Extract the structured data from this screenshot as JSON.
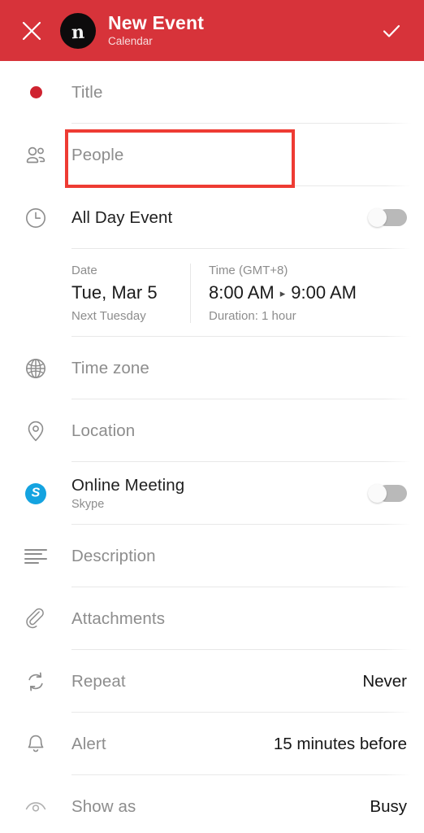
{
  "header": {
    "close_icon": "close-x-icon",
    "avatar_glyph": "n",
    "title": "New Event",
    "subtitle": "Calendar",
    "done_icon": "checkmark-icon",
    "background_color": "#d7333a"
  },
  "form": {
    "title_field": {
      "icon": "calendar-color-dot-icon",
      "placeholder": "Title",
      "value": ""
    },
    "people_field": {
      "icon": "people-icon",
      "placeholder": "People",
      "value": ""
    },
    "all_day": {
      "icon": "clock-icon",
      "label": "All Day Event",
      "toggle_state": "off"
    },
    "datetime": {
      "date_header": "Date",
      "date_value": "Tue, Mar 5",
      "date_relative": "Next Tuesday",
      "time_header": "Time (GMT+8)",
      "time_start": "8:00 AM",
      "time_arrow": "▸",
      "time_end": "9:00 AM",
      "duration": "Duration: 1 hour"
    },
    "time_zone": {
      "icon": "globe-icon",
      "placeholder": "Time zone",
      "value": ""
    },
    "location": {
      "icon": "map-pin-icon",
      "placeholder": "Location",
      "value": ""
    },
    "online_meeting": {
      "icon": "skype-icon",
      "label": "Online Meeting",
      "provider": "Skype",
      "toggle_state": "off"
    },
    "description": {
      "icon": "description-lines-icon",
      "placeholder": "Description",
      "value": ""
    },
    "attachments": {
      "icon": "paperclip-icon",
      "placeholder": "Attachments",
      "value": ""
    },
    "repeat": {
      "icon": "repeat-icon",
      "label": "Repeat",
      "value": "Never"
    },
    "alert": {
      "icon": "bell-icon",
      "label": "Alert",
      "value": "15 minutes before"
    },
    "show_as": {
      "icon": "eye-icon",
      "label": "Show as",
      "value": "Busy"
    }
  },
  "annotation": {
    "target": "people-field",
    "color": "#ee3b33"
  }
}
